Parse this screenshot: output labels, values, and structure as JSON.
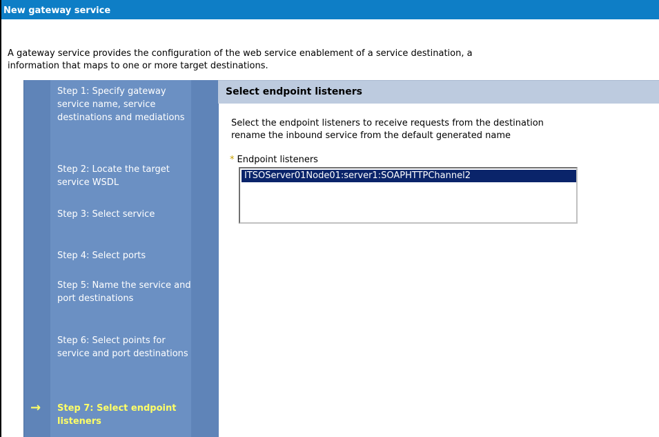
{
  "window": {
    "title": "New gateway service"
  },
  "intro": {
    "line1": "A gateway service provides the configuration of the web service enablement of a service destination, a",
    "line2": "information that maps to one or more target destinations."
  },
  "sidebar": {
    "steps": [
      {
        "label": "Step 1: Specify gateway service name, service destinations and mediations",
        "current": false
      },
      {
        "label": "Step 2: Locate the target service WSDL",
        "current": false
      },
      {
        "label": "Step 3: Select service",
        "current": false
      },
      {
        "label": "Step 4: Select ports",
        "current": false
      },
      {
        "label": "Step 5: Name the service and port destinations",
        "current": false
      },
      {
        "label": "Step 6: Select points for service and port destinations",
        "current": false
      },
      {
        "label": "Step 7: Select endpoint listeners",
        "current": true
      }
    ],
    "current_arrow": "→"
  },
  "main": {
    "heading": "Select endpoint listeners",
    "description_line1": "Select the endpoint listeners to receive requests from the destination",
    "description_line2": "rename the inbound service from the default generated name",
    "field": {
      "required_marker": "*",
      "label": "Endpoint listeners",
      "options": [
        "ITSOServer01Node01:server1:SOAPHTTPChannel2"
      ],
      "selected": "ITSOServer01Node01:server1:SOAPHTTPChannel2"
    }
  },
  "colors": {
    "title_bar": "#0e7ec6",
    "sidebar": "#6b90c3",
    "current_step": "#ffff66",
    "section_header": "#bdcbdf",
    "selection": "#0a246a"
  }
}
